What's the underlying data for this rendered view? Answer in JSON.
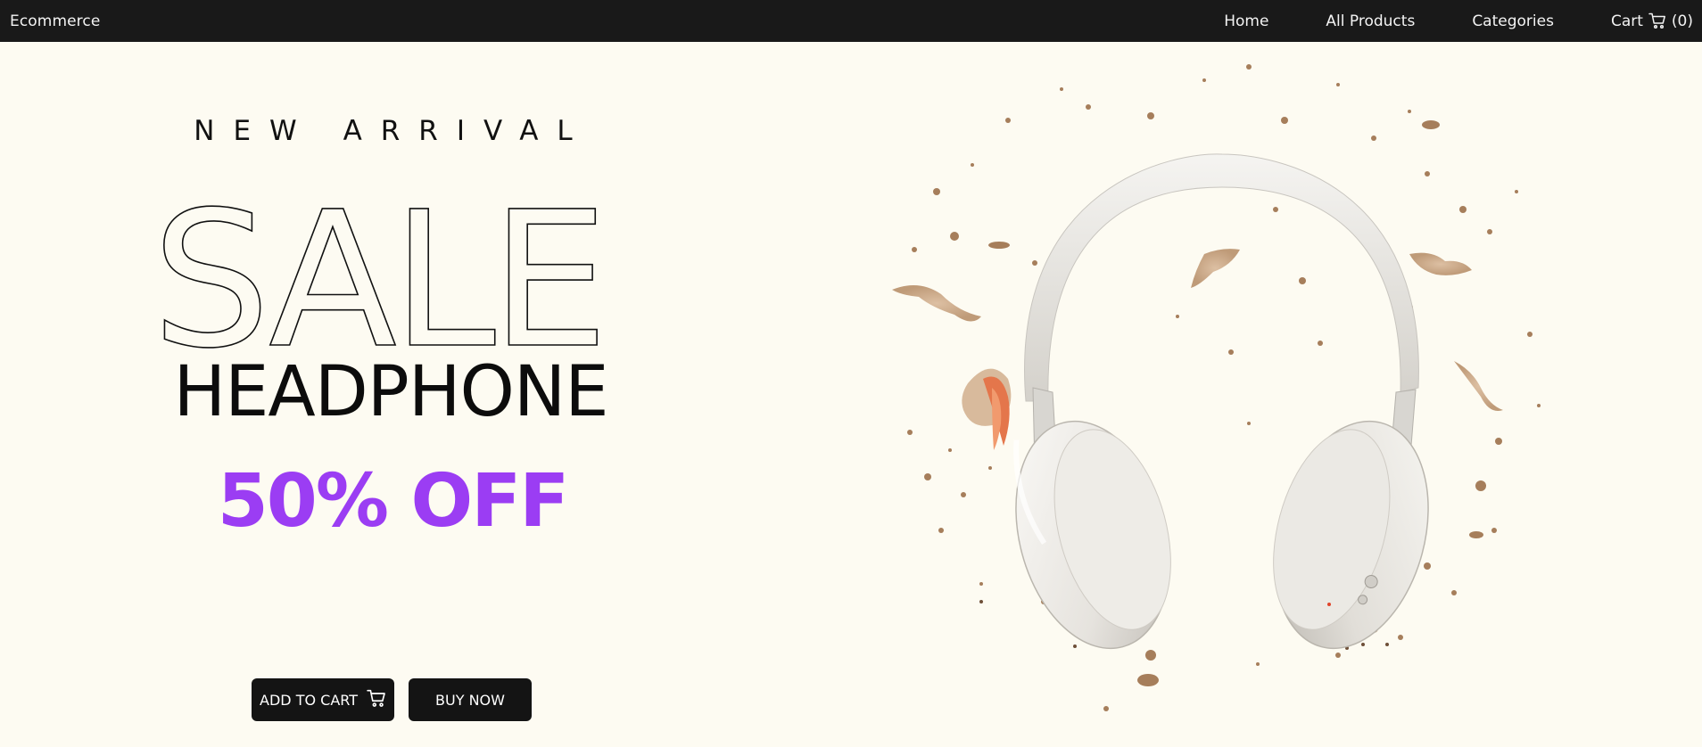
{
  "navbar": {
    "brand": "Ecommerce",
    "links": [
      {
        "label": "Home"
      },
      {
        "label": "All Products"
      },
      {
        "label": "Categories"
      }
    ],
    "cart": {
      "label": "Cart",
      "count": "(0)",
      "icon": "cart-icon"
    }
  },
  "hero": {
    "eyebrow": "NEW ARRIVAL",
    "sale_word": "SALE",
    "product_word": "HEADPHONE",
    "discount": "50% OFF",
    "discount_color": "#9b3df3",
    "buttons": {
      "add_to_cart": "ADD TO CART",
      "add_to_cart_icon": "cart-icon",
      "buy_now": "BUY NOW"
    },
    "image": {
      "subject": "white over-ear headphones with scattered debris",
      "icon": "headphones-image"
    }
  },
  "colors": {
    "navbar_bg": "#191919",
    "page_bg": "#fdfbf2",
    "button_bg": "#141414",
    "accent": "#9b3df3"
  }
}
